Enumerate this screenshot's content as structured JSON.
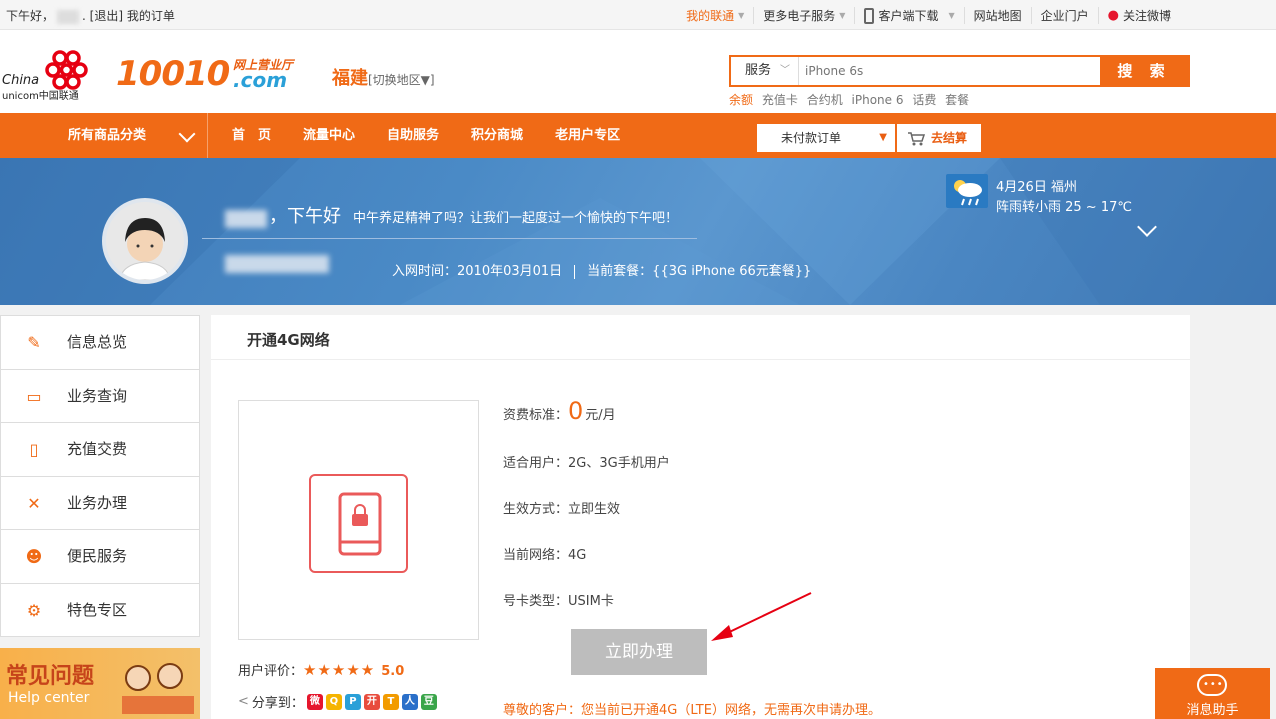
{
  "topbar": {
    "greeting": "下午好，",
    "suffix": ".",
    "logout": "[退出]",
    "my_orders": "我的订单",
    "right_items": [
      "我的联通",
      "更多电子服务",
      "客户端下载",
      "网站地图",
      "企业门户",
      "关注微博"
    ]
  },
  "header": {
    "logo_china": "China",
    "logo_unicom": "unicom中国联通",
    "logo_number": "10010",
    "logo_tag": "网上营业厅",
    "logo_com": ".com",
    "region": "福建",
    "region_switch": "[切换地区▼]",
    "search_category": "服务",
    "search_placeholder": "iPhone 6s",
    "search_button": "搜 索",
    "hot_words": [
      "余额",
      "充值卡",
      "合约机",
      "iPhone 6",
      "话费",
      "套餐"
    ]
  },
  "nav": {
    "all_categories": "所有商品分类",
    "links": [
      "首　页",
      "流量中心",
      "自助服务",
      "积分商城",
      "老用户专区"
    ],
    "unpaid_orders": "未付款订单",
    "checkout": "去结算"
  },
  "banner": {
    "greeting": "，下午好",
    "message": "中午养足精神了吗？让我们一起度过一个愉快的下午吧！",
    "join_time": "入网时间：2010年03月01日",
    "current_plan": "当前套餐：{{3G iPhone 66元套餐}}",
    "weather_date": "4月26日 福州",
    "weather_desc": "阵雨转小雨 25 ~ 17℃"
  },
  "sidebar": {
    "items": [
      {
        "label": "信息总览",
        "icon": "overview-icon"
      },
      {
        "label": "业务查询",
        "icon": "query-icon"
      },
      {
        "label": "充值交费",
        "icon": "phone-pay-icon"
      },
      {
        "label": "业务办理",
        "icon": "tools-icon"
      },
      {
        "label": "便民服务",
        "icon": "people-icon"
      },
      {
        "label": "特色专区",
        "icon": "gear-icon"
      }
    ],
    "help_title": "常见问题",
    "help_subtitle": "Help center"
  },
  "content": {
    "title": "开通4G网络",
    "price_label": "资费标准：",
    "price_value": "0",
    "price_unit": "元/月",
    "users": "适合用户：2G、3G手机用户",
    "effect": "生效方式：立即生效",
    "network": "当前网络：4G",
    "card_type": "号卡类型：USIM卡",
    "apply_button": "立即办理",
    "rating_label": "用户评价：",
    "rating_stars": "★★★★★",
    "rating_score": "5.0",
    "share_label": "分享到：",
    "notice": "尊敬的客户：您当前已开通4G（LTE）网络，无需再次申请办理。"
  },
  "float": {
    "message_helper": "消息助手"
  },
  "colors": {
    "brand_orange": "#f06a16",
    "banner_blue": "#4a86c2"
  }
}
